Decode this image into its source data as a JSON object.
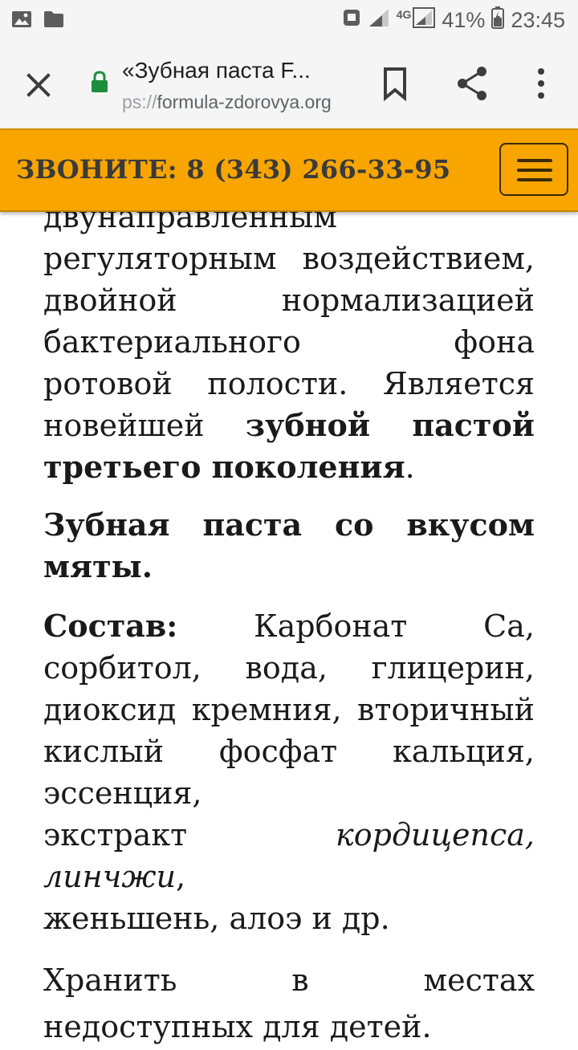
{
  "status_bar": {
    "network": "4G",
    "battery": "41%",
    "time": "23:45",
    "icons": [
      "gallery-icon",
      "folder-icon",
      "screenshot-icon",
      "signal-icon",
      "battery-icon"
    ]
  },
  "toolbar": {
    "page_title": "«Зубная паста F...",
    "url_scheme": "ps://",
    "url_host": "formula-zdorovya.org",
    "icons": [
      "close-icon",
      "lock-icon",
      "bookmark-icon",
      "share-icon",
      "more-vert-icon"
    ]
  },
  "banner": {
    "phone_text": "ЗВОНИТЕ: 8 (343) 266-33-95",
    "menu_icon": "hamburger-icon",
    "color": "#f8a500"
  },
  "article": {
    "p1": {
      "l1": "двунаправленным",
      "l2": "регуляторным воздействием,",
      "l3": "двойной нормализацией",
      "l4": "бактериального фона",
      "l5": "ротовой полости. Является",
      "l6_a": "новейшей ",
      "l6_b": "зубной пастой",
      "l7_b": "третьего поколения",
      "l7_end": "."
    },
    "p2": {
      "l1": "Зубная паста со вкусом",
      "l2": "мяты."
    },
    "p3": {
      "label": "Состав:",
      "l1_rest": " Карбонат Са,",
      "l2": "сорбитол, вода, глицерин,",
      "l3": "диоксид кремния, вторичный",
      "l4": "кислый фосфат кальция,",
      "l5": "эссенция,",
      "l6_a": "экстракт ",
      "l6_i": "кордицепса, линчжи",
      "l6_end": ",",
      "l7": "женьшень, алоэ и др."
    },
    "p4": {
      "l1": "Хранить в местах",
      "l2": "недоступных для детей."
    }
  }
}
